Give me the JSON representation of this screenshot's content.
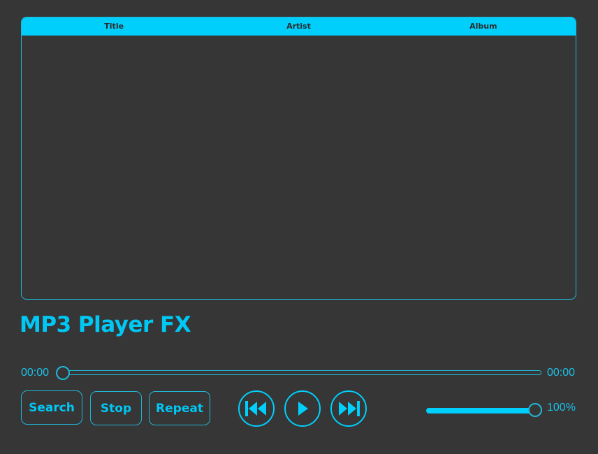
{
  "app": {
    "title": "MP3 Player FX"
  },
  "playlist": {
    "columns": [
      "Title",
      "Artist",
      "Album"
    ],
    "rows": []
  },
  "playback": {
    "current_time": "00:00",
    "total_time": "00:00",
    "progress_fraction": 0.0
  },
  "buttons": {
    "search": "Search",
    "stop": "Stop",
    "repeat": "Repeat"
  },
  "transport": {
    "previous_icon": "skip-previous-icon",
    "play_icon": "play-icon",
    "next_icon": "skip-next-icon"
  },
  "volume": {
    "value_percent": 100,
    "label": "100%"
  },
  "colors": {
    "accent": "#00cffc",
    "background": "#363636",
    "header_text": "#2a2a2a"
  }
}
